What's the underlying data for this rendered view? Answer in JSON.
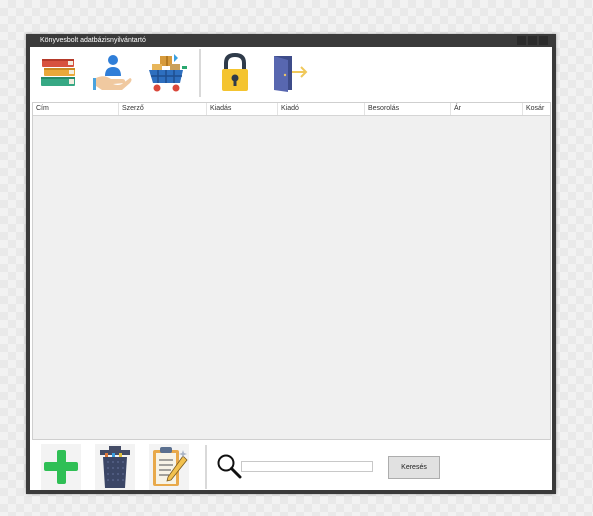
{
  "window": {
    "title": "Könyvesbolt adatbázisnyilvántartó"
  },
  "toolbar": {
    "icons": [
      "books-icon",
      "user-hand-icon",
      "shopping-cart-icon",
      "padlock-icon",
      "exit-door-icon"
    ]
  },
  "table": {
    "columns": [
      "Cím",
      "Szerző",
      "Kiadás",
      "Kiadó",
      "Besorolás",
      "Ár",
      "Kosár"
    ],
    "rows": []
  },
  "bottombar": {
    "icons": [
      "add-plus-icon",
      "trash-bin-icon",
      "edit-clipboard-icon",
      "magnifier-icon"
    ],
    "search_value": "",
    "search_button_label": "Keresés"
  },
  "colors": {
    "titlebar": "#3a3a3a",
    "grid_background": "#f0f0f0",
    "add_green": "#2fbf55",
    "lock_yellow": "#f4c430",
    "door_blue": "#5867b0"
  }
}
